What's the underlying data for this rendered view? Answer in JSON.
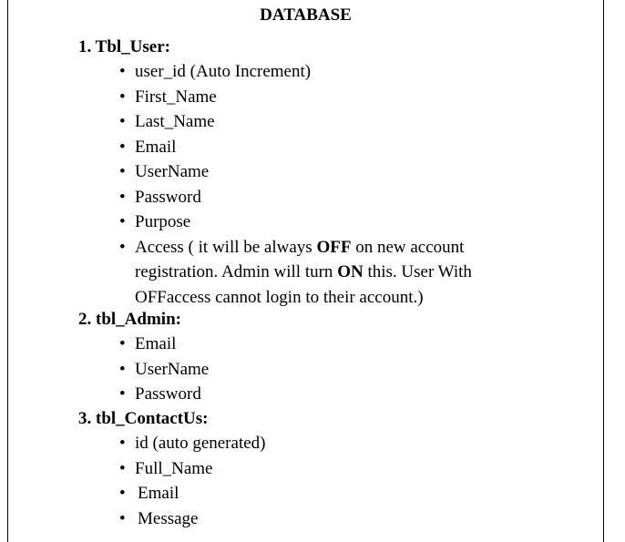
{
  "title": "DATABASE",
  "tables": [
    {
      "heading": "1. Tbl_User:",
      "fields": [
        "user_id (Auto Increment)",
        "First_Name",
        "Last_Name",
        "Email",
        "UserName",
        "Password",
        "Purpose"
      ],
      "access_note": {
        "part1": "Access ( it will be always ",
        "off1": "OFF",
        "part2": " on new account registration. Admin will turn ",
        "on": "ON",
        "part3": " this. User With OFFaccess cannot login to their account.)"
      }
    },
    {
      "heading": "2. tbl_Admin:",
      "fields": [
        "Email",
        "UserName",
        "Password"
      ]
    },
    {
      "heading": "3. tbl_ContactUs:",
      "fields": [
        "id (auto generated)",
        "Full_Name",
        "Email",
        "Message"
      ]
    }
  ]
}
